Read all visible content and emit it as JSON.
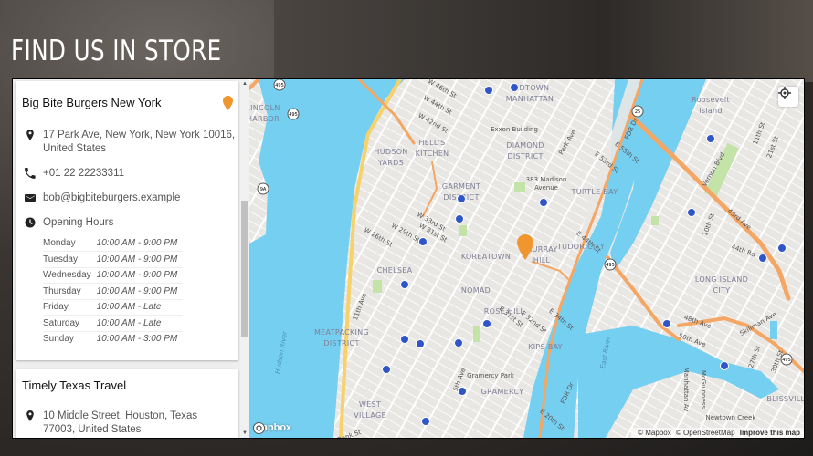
{
  "page": {
    "title": "FIND US IN STORE"
  },
  "stores": [
    {
      "name": "Big Bite Burgers New York",
      "address": "17 Park Ave, New York, New York 10016, United States",
      "phone": "+01 22 22233311",
      "email": "bob@bigbiteburgers.example",
      "hours_label": "Opening Hours",
      "hours": [
        {
          "day": "Monday",
          "time": "10:00 AM - 9:00 PM"
        },
        {
          "day": "Tuesday",
          "time": "10:00 AM - 9:00 PM"
        },
        {
          "day": "Wednesday",
          "time": "10:00 AM - 9:00 PM"
        },
        {
          "day": "Thursday",
          "time": "10:00 AM - 9:00 PM"
        },
        {
          "day": "Friday",
          "time": "10:00 AM - Late"
        },
        {
          "day": "Saturday",
          "time": "10:00 AM - Late"
        },
        {
          "day": "Sunday",
          "time": "10:00 AM - 3:00 PM"
        }
      ]
    },
    {
      "name": "Timely Texas Travel",
      "address": "10 Middle Street, Houston, Texas 77003, United States"
    }
  ],
  "map": {
    "marker_color": "#f0962e",
    "water_color": "#75cff0",
    "logo": "mapbox",
    "attribution": [
      "© Mapbox",
      "© OpenStreetMap",
      "Improve this map"
    ],
    "areas": [
      "MIDTOWN",
      "MANHATTAN",
      "LINCOLN",
      "HARBOR",
      "HUDSON",
      "YARDS",
      "HELL'S",
      "KITCHEN",
      "DIAMOND",
      "DISTRICT",
      "GARMENT",
      "DISTRICT",
      "TURTLE BAY",
      "KOREATOWN",
      "MURRAY",
      "HILL",
      "TUDOR CITY",
      "CHELSEA",
      "NOMAD",
      "ROSE HILL",
      "MEATPACKING",
      "DISTRICT",
      "KIPS BAY",
      "GRAMERCY",
      "WEST",
      "VILLAGE",
      "LONG ISLAND",
      "CITY",
      "BLISSVILLE",
      "Roosevelt",
      "Island"
    ],
    "pois": [
      "Exxon Building",
      "383 Madison",
      "Avenue",
      "Gramercy Park",
      "Newtown Creek"
    ],
    "streets": [
      "W 46th St",
      "W 44th St",
      "W 42nd St",
      "W 33rd St",
      "W 31st St",
      "W 29th St",
      "W 26th St",
      "11th Ave",
      "5th Ave",
      "Park Ave",
      "E 53rd St",
      "E 55th St",
      "E 44th St",
      "E 34th St",
      "E 32nd St",
      "E 31st St",
      "E 20th St",
      "FDR Dr",
      "FDR Dr",
      "Bank St",
      "Vernon Blvd",
      "43rd Ave",
      "44th Rd",
      "48th Ave",
      "50th Ave",
      "Skillman Ave",
      "Manhattan Av",
      "McGuinness",
      "10th St",
      "11th St",
      "21st St",
      "27th St",
      "30th St"
    ],
    "water_labels": [
      "Hudson River",
      "East River"
    ],
    "shields": [
      "495",
      "495",
      "9A",
      "25",
      "495",
      "495"
    ]
  }
}
